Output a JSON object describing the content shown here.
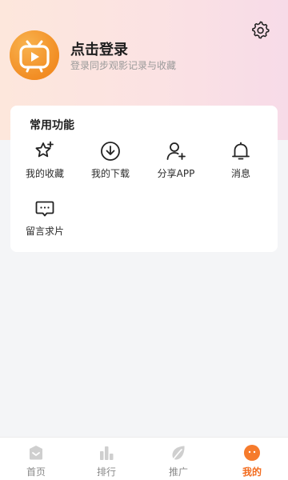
{
  "header": {
    "login_title": "点击登录",
    "login_subtitle": "登录同步观影记录与收藏",
    "settings_icon": "gear-icon",
    "avatar_icon": "tv-play-logo",
    "accent": "#f6a028"
  },
  "common": {
    "title": "常用功能",
    "items": [
      {
        "label": "我的收藏",
        "icon": "star-plus-icon"
      },
      {
        "label": "我的下载",
        "icon": "download-icon"
      },
      {
        "label": "分享APP",
        "icon": "user-plus-icon"
      },
      {
        "label": "消息",
        "icon": "bell-icon"
      },
      {
        "label": "留言求片",
        "icon": "message-icon"
      }
    ]
  },
  "tabbar": {
    "active_color": "#f26b1d",
    "items": [
      {
        "label": "首页",
        "icon": "home-icon",
        "active": false
      },
      {
        "label": "排行",
        "icon": "bar-chart-icon",
        "active": false
      },
      {
        "label": "推广",
        "icon": "leaf-icon",
        "active": false
      },
      {
        "label": "我的",
        "icon": "face-icon",
        "active": true
      }
    ]
  }
}
